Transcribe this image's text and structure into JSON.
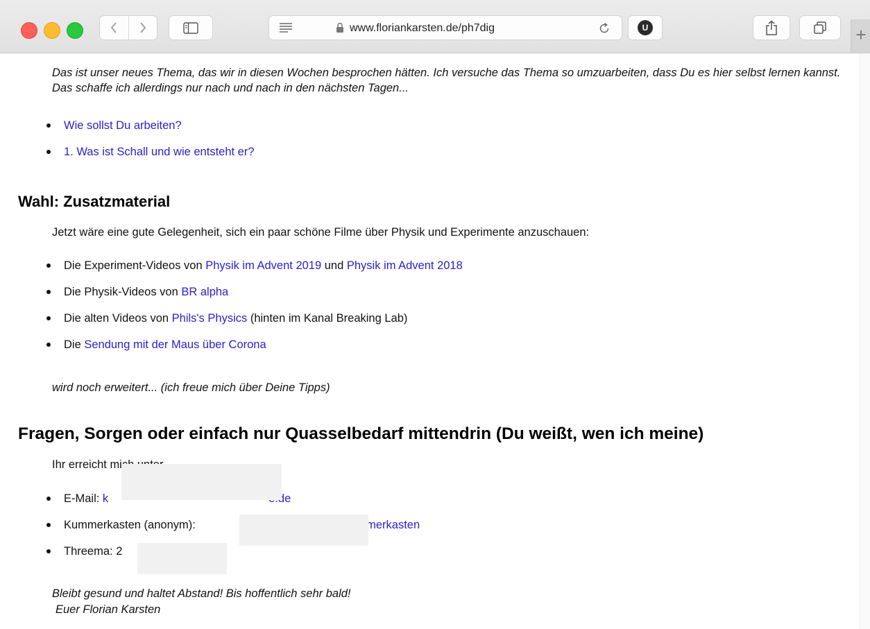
{
  "browser": {
    "url": "www.floriankarsten.de/ph7dig",
    "ublock_badge": "U",
    "new_tab": "+"
  },
  "page": {
    "intro": "Das ist unser neues Thema, das wir in diesen Wochen besprochen hätten. Ich versuche das Thema so umzuarbeiten, dass Du es hier selbst lernen kannst. Das schaffe ich allerdings nur nach und nach in den nächsten Tagen...",
    "topic_links": [
      "Wie sollst Du arbeiten?",
      "1. Was ist Schall und wie entsteht er?"
    ],
    "section_extra": {
      "heading": "Wahl: Zusatzmaterial",
      "text": "Jetzt wäre eine gute Gelegenheit, sich ein paar schöne Filme über Physik und Experimente anzuschauen:",
      "item1": {
        "prefix": "Die Experiment-Videos von ",
        "link1": "Physik im Advent 2019",
        "middle": " und ",
        "link2": "Physik im Advent 2018"
      },
      "item2": {
        "prefix": "Die Physik-Videos von ",
        "link": "BR alpha"
      },
      "item3": {
        "prefix": "Die alten Videos von ",
        "link": "Phils's Physics",
        "suffix": " (hinten im Kanal Breaking Lab)"
      },
      "item4": {
        "prefix": "Die ",
        "link": "Sendung mit der Maus über Corona"
      },
      "note": "wird noch erweitert... (ich freue mich über Deine Tipps)"
    },
    "section_contact": {
      "heading": "Fragen, Sorgen oder einfach nur Quasselbedarf mittendrin (Du weißt, wen ich meine)",
      "text": "Ihr erreicht mich unter",
      "email": {
        "label": "E-Mail: ",
        "link_start": "k",
        "link_end": "e.de"
      },
      "kummerkasten": {
        "label": "Kummerkasten (anonym): ",
        "link_end": ".de/kummerkasten"
      },
      "threema": {
        "label": "Threema: ",
        "value_start": "2"
      },
      "closing_line1": "Bleibt gesund und haltet Abstand! Bis hoffentlich sehr bald!",
      "closing_line2": "Euer Florian Karsten"
    }
  }
}
